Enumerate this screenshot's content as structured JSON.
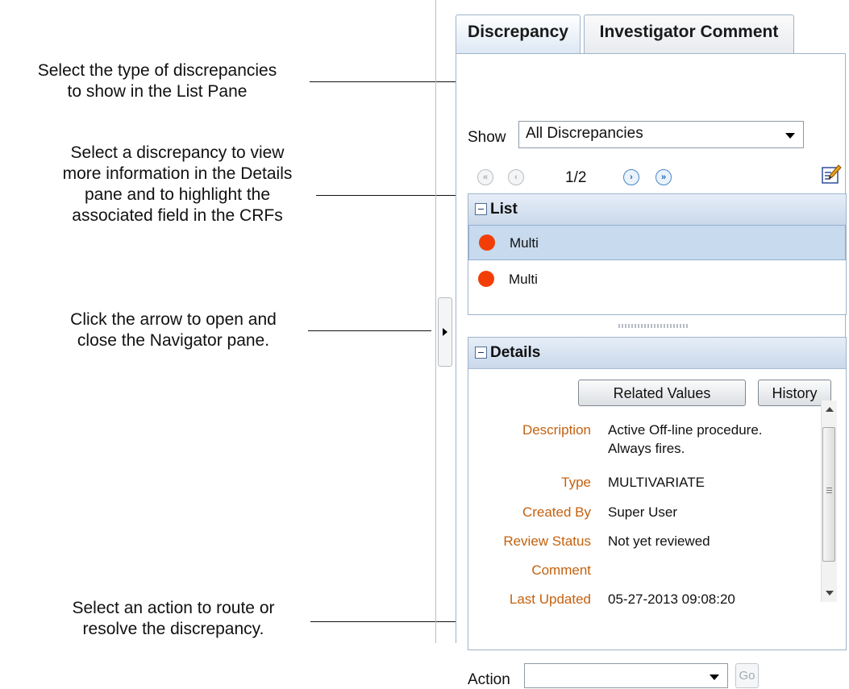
{
  "callouts": {
    "show_type": "Select the type of discrepancies to show in the List Pane",
    "show_type_lines": [
      "Select the type of discrepancies",
      "to show in the List Pane"
    ],
    "select_discrepancy_lines": [
      "Select a discrepancy to view",
      "more information in the Details",
      "pane and to highlight the",
      "associated field in the CRFs"
    ],
    "arrow_lines": [
      "Click the arrow to open and",
      "close the Navigator pane."
    ],
    "action_lines": [
      "Select an action to route or",
      "resolve the discrepancy."
    ]
  },
  "tabs": [
    {
      "label": "Discrepancy",
      "active": true
    },
    {
      "label": "Investigator Comment",
      "active": false
    }
  ],
  "filter": {
    "label": "Show",
    "selected": "All Discrepancies"
  },
  "pager": {
    "first": "«",
    "prev": "‹",
    "page": "1/2",
    "next": "›",
    "last": "»"
  },
  "list": {
    "title": "List",
    "items": [
      {
        "label": "Multi",
        "selected": true,
        "status_color": "#f23e06"
      },
      {
        "label": "Multi",
        "selected": false,
        "status_color": "#f23e06"
      }
    ]
  },
  "details": {
    "title": "Details",
    "buttons": {
      "related_values": "Related Values",
      "history": "History"
    },
    "fields": [
      {
        "label": "Description",
        "value_lines": [
          "Active Off-line procedure.",
          "Always fires."
        ]
      },
      {
        "label": "Type",
        "value_lines": [
          "MULTIVARIATE"
        ]
      },
      {
        "label": "Created By",
        "value_lines": [
          "Super User"
        ]
      },
      {
        "label": "Review Status",
        "value_lines": [
          "Not yet reviewed"
        ]
      },
      {
        "label": "Comment",
        "value_lines": [
          ""
        ]
      },
      {
        "label": "Last Updated",
        "value_lines": [
          "05-27-2013 09:08:20"
        ]
      }
    ]
  },
  "action": {
    "label": "Action",
    "selected": "",
    "go_label": "Go"
  },
  "colors": {
    "accent_label": "#c4610e",
    "status_dot": "#f23e06",
    "selected_row": "#c7daee",
    "header_gradient_bottom": "#c9d8ea"
  },
  "icons": {
    "edit": "edit-pencil-icon",
    "collapse": "collapse-arrow-icon"
  }
}
